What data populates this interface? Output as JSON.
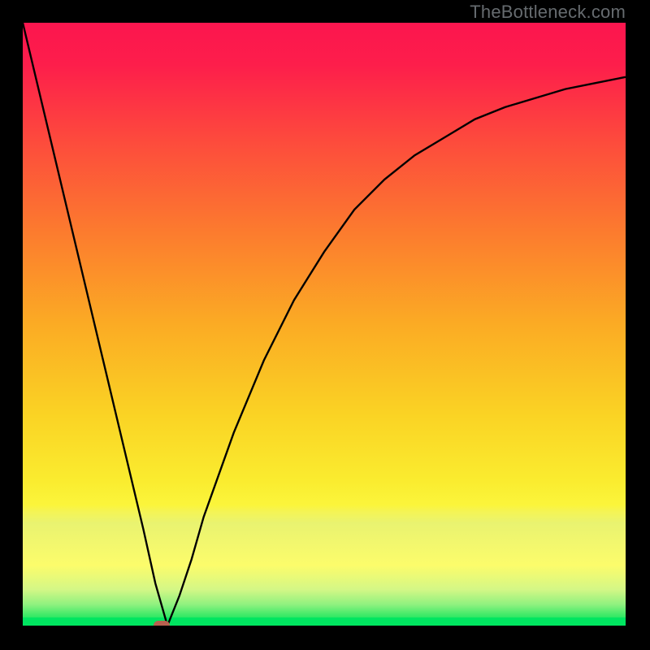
{
  "watermark": "TheBottleneck.com",
  "chart_data": {
    "type": "line",
    "title": "",
    "xlabel": "",
    "ylabel": "",
    "xlim": [
      0,
      100
    ],
    "ylim": [
      0,
      100
    ],
    "grid": false,
    "legend": false,
    "x": [
      0,
      5,
      10,
      15,
      20,
      22,
      24,
      26,
      28,
      30,
      35,
      40,
      45,
      50,
      55,
      60,
      65,
      70,
      75,
      80,
      85,
      90,
      95,
      100
    ],
    "y": [
      100,
      79,
      58,
      37,
      16,
      7,
      0,
      5,
      11,
      18,
      32,
      44,
      54,
      62,
      69,
      74,
      78,
      81,
      84,
      86,
      87.5,
      89,
      90,
      91
    ],
    "marker": {
      "x": 23,
      "y": 0,
      "color": "#b8614f"
    },
    "background_gradient": {
      "type": "linear-vertical",
      "stops": [
        {
          "pos": 0.0,
          "color": "#fc154e"
        },
        {
          "pos": 0.07,
          "color": "#fd1e4b"
        },
        {
          "pos": 0.2,
          "color": "#fd4c3c"
        },
        {
          "pos": 0.35,
          "color": "#fc7c2e"
        },
        {
          "pos": 0.5,
          "color": "#fbab24"
        },
        {
          "pos": 0.65,
          "color": "#fad324"
        },
        {
          "pos": 0.76,
          "color": "#faec2f"
        },
        {
          "pos": 0.8,
          "color": "#fbf53b"
        },
        {
          "pos": 0.81,
          "color": "#f5f453"
        },
        {
          "pos": 0.83,
          "color": "#e9f370"
        },
        {
          "pos": 0.9,
          "color": "#fcfc6b"
        },
        {
          "pos": 0.94,
          "color": "#d4f786"
        },
        {
          "pos": 0.965,
          "color": "#8ff17f"
        },
        {
          "pos": 0.985,
          "color": "#33e965"
        },
        {
          "pos": 1.0,
          "color": "#00e560"
        }
      ]
    }
  }
}
